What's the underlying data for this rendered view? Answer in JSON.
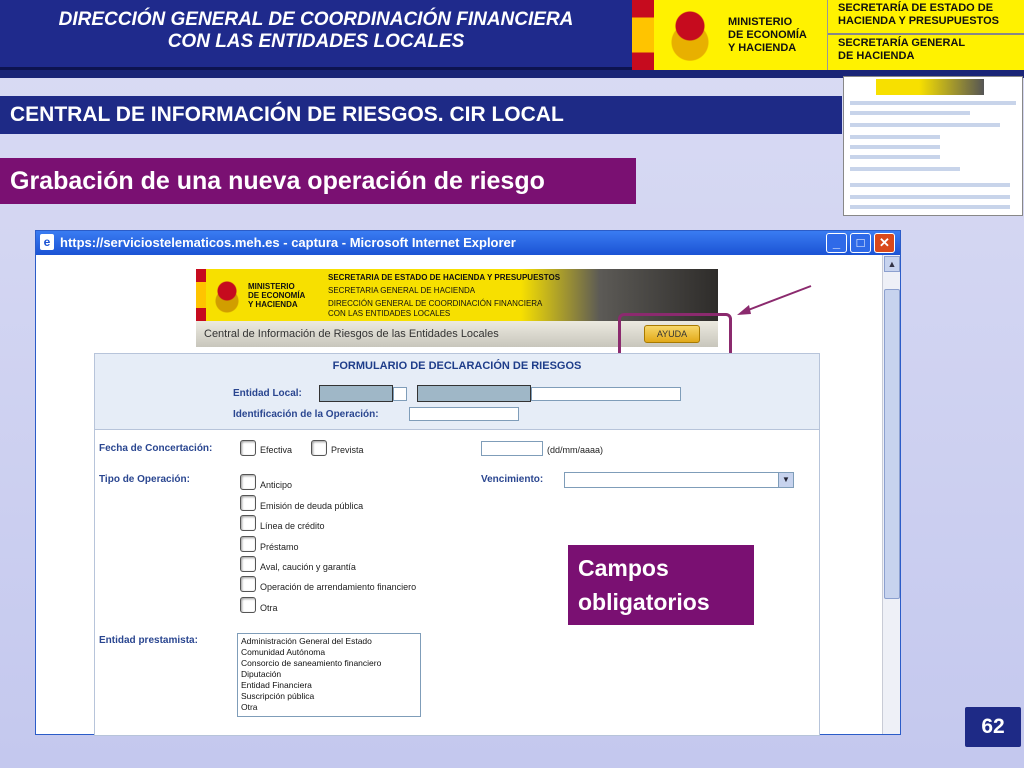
{
  "header": {
    "title_line1": "DIRECCIÓN GENERAL DE COORDINACIÓN FINANCIERA",
    "title_line2": "CON LAS ENTIDADES LOCALES",
    "ministry": [
      "MINISTERIO",
      "DE ECONOMÍA",
      "Y HACIENDA"
    ],
    "secretaria_estado": [
      "SECRETARÍA DE ESTADO DE",
      "HACIENDA Y PRESUPUESTOS"
    ],
    "secretaria_general": [
      "SECRETARÍA GENERAL",
      "DE HACIENDA"
    ]
  },
  "section_title": "CENTRAL DE INFORMACIÓN DE RIESGOS. CIR LOCAL",
  "subsection_title": "Grabación de una nueva operación de riesgo",
  "browser": {
    "window_title": "https://serviciostelematicos.meh.es - captura - Microsoft Internet Explorer",
    "banner": {
      "ministry": [
        "MINISTERIO",
        "DE ECONOMÍA",
        "Y HACIENDA"
      ],
      "lines": [
        "SECRETARIA DE ESTADO DE HACIENDA Y PRESUPUESTOS",
        "SECRETARIA GENERAL DE HACIENDA",
        "DIRECCIÓN GENERAL DE COORDINACIÓN FINANCIERA",
        "CON LAS ENTIDADES LOCALES"
      ],
      "subtitle": "Central de Información de Riesgos de las Entidades Locales",
      "help_button": "AYUDA"
    },
    "form": {
      "title": "FORMULARIO DE DECLARACIÓN DE RIESGOS",
      "entidad_local_label": "Entidad Local:",
      "identificacion_label": "Identificación de la Operación:",
      "fecha_label": "Fecha de Concertación:",
      "fecha_options": [
        "Efectiva",
        "Prevista"
      ],
      "fecha_format": "(dd/mm/aaaa)",
      "tipo_label": "Tipo de Operación:",
      "tipo_options": [
        "Anticipo",
        "Emisión de deuda pública",
        "Línea de crédito",
        "Préstamo",
        "Aval, caución y garantía",
        "Operación de arrendamiento financiero",
        "Otra"
      ],
      "vencimiento_label": "Vencimiento:",
      "prestamista_label": "Entidad prestamista:",
      "prestamista_options": [
        "Administración General del Estado",
        "Comunidad Autónoma",
        "Consorcio de saneamiento financiero",
        "Diputación",
        "Entidad Financiera",
        "Suscripción pública",
        "Otra"
      ]
    }
  },
  "callout": [
    "Campos",
    "obligatorios"
  ],
  "page_number": "62",
  "colors": {
    "navy": "#1e2a86",
    "purple": "#7a1072",
    "yellow": "#fff200"
  }
}
